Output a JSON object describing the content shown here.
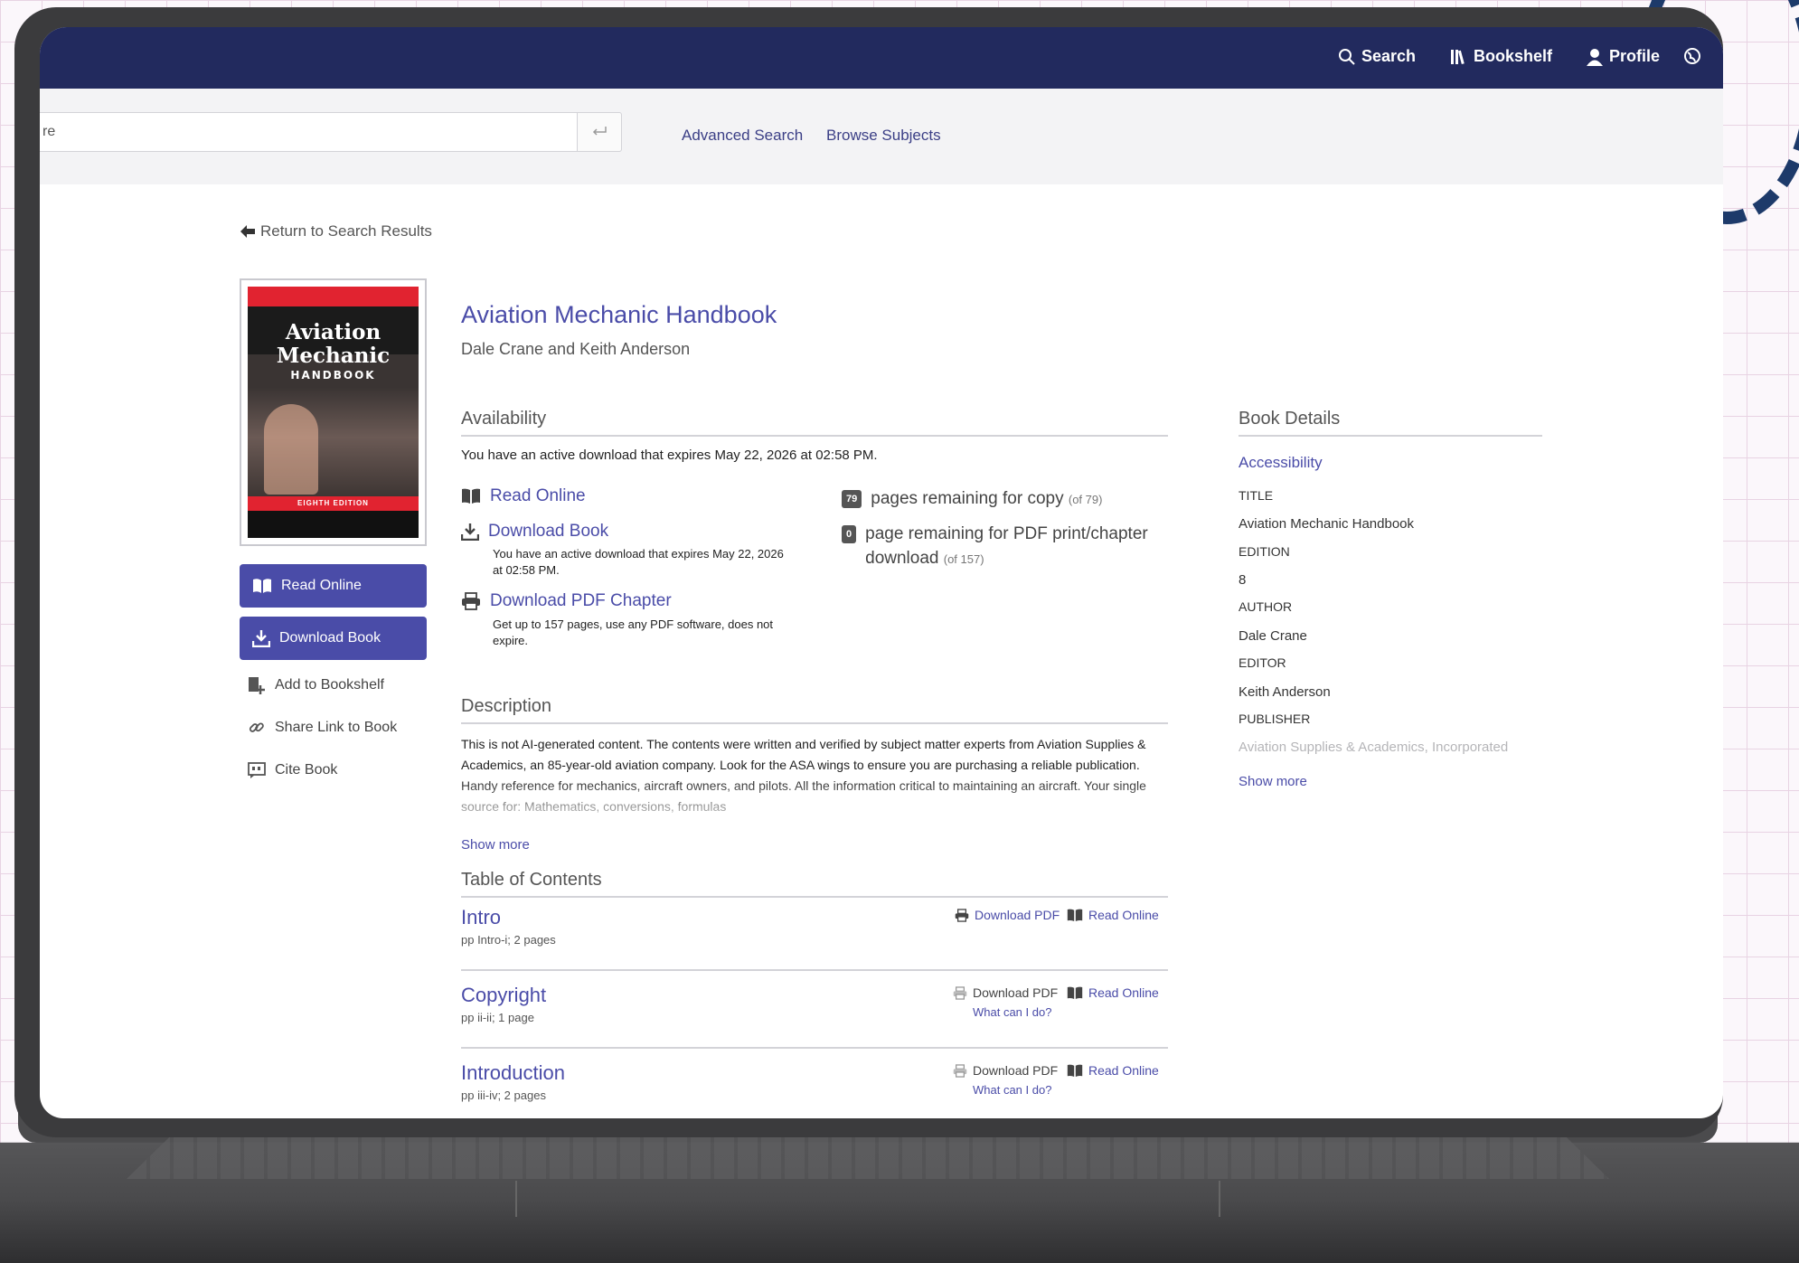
{
  "navbar": {
    "items": [
      {
        "label": "Search",
        "icon": "search-icon"
      },
      {
        "label": "Bookshelf",
        "icon": "bookshelf-icon"
      },
      {
        "label": "Profile",
        "icon": "user-icon"
      }
    ]
  },
  "searchbar": {
    "value": "re",
    "links": [
      "Advanced Search",
      "Browse Subjects"
    ]
  },
  "return_link": "Return to Search Results",
  "cover": {
    "title_line1": "Aviation",
    "title_line2": "Mechanic",
    "title_line3": "HANDBOOK",
    "edition": "EIGHTH EDITION"
  },
  "side_actions": {
    "read_online": "Read Online",
    "download_book": "Download Book",
    "add_to_bookshelf": "Add to Bookshelf",
    "share_link": "Share Link to Book",
    "cite_book": "Cite Book"
  },
  "book": {
    "title": "Aviation Mechanic Handbook",
    "authors": "Dale Crane and Keith Anderson"
  },
  "availability": {
    "heading": "Availability",
    "active_download": "You have an active download that expires May 22, 2026 at 02:58 PM.",
    "read_online": "Read Online",
    "download_book": "Download Book",
    "download_book_note": "You have an active download that expires May 22, 2026 at 02:58 PM.",
    "download_pdf_chapter": "Download PDF Chapter",
    "download_pdf_chapter_note": "Get up to 157 pages, use any PDF software, does not expire.",
    "copy_count": "79",
    "copy_text": "pages remaining for copy",
    "copy_total": "(of 79)",
    "pdf_count": "0",
    "pdf_text": "page remaining for PDF print/chapter download",
    "pdf_total": "(of 157)"
  },
  "description": {
    "heading": "Description",
    "text": "This is not AI-generated content. The contents were written and verified by subject matter experts from Aviation Supplies & Academics, an 85-year-old aviation company. Look for the ASA wings to ensure you are purchasing a reliable publication. Handy reference for mechanics, aircraft owners, and pilots. All the information critical to maintaining an aircraft. Your single source for: Mathematics, conversions, formulas",
    "show_more": "Show more"
  },
  "toc": {
    "heading": "Table of Contents",
    "download_pdf": "Download PDF",
    "read_online": "Read Online",
    "what_can_i_do": "What can I do?",
    "items": [
      {
        "title": "Intro",
        "pages": "pp Intro-i; 2 pages"
      },
      {
        "title": "Copyright",
        "pages": "pp ii-ii; 1 page"
      },
      {
        "title": "Introduction",
        "pages": "pp iii-iv; 2 pages"
      }
    ]
  },
  "details": {
    "heading": "Book Details",
    "accessibility": "Accessibility",
    "title_label": "TITLE",
    "title_value": "Aviation Mechanic Handbook",
    "edition_label": "EDITION",
    "edition_value": "8",
    "author_label": "AUTHOR",
    "author_value": "Dale Crane",
    "editor_label": "EDITOR",
    "editor_value": "Keith Anderson",
    "publisher_label": "PUBLISHER",
    "publisher_value": "Aviation Supplies & Academics, Incorporated",
    "show_more": "Show more"
  },
  "colors": {
    "navbar": "#222a5e",
    "accent": "#4a4ca8",
    "cover_red": "#e12330"
  }
}
